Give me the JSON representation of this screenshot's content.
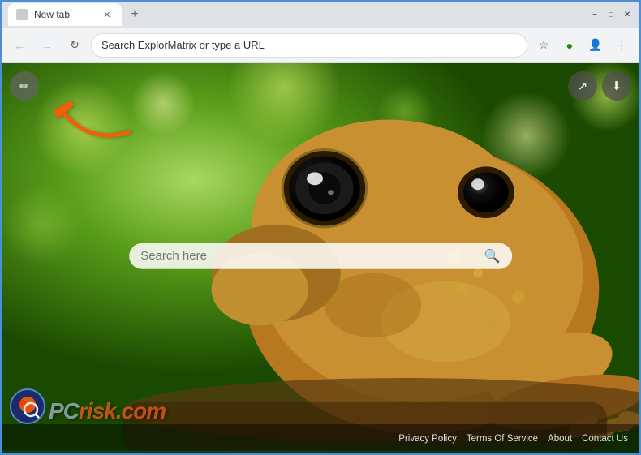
{
  "browser": {
    "tab_label": "New tab",
    "new_tab_btn": "+",
    "window_controls": {
      "minimize": "−",
      "maximize": "□",
      "close": "✕"
    }
  },
  "address_bar": {
    "back_btn": "←",
    "forward_btn": "→",
    "refresh_btn": "↻",
    "url_placeholder": "Search ExplorMatrix or type a URL",
    "url_value": "Search ExplorMatrix or type a URL",
    "bookmark_icon": "☆",
    "extension_icon": "●",
    "profile_icon": "👤",
    "menu_icon": "⋮"
  },
  "page": {
    "customize_btn_icon": "✏",
    "search_placeholder": "Search here",
    "search_icon": "🔍",
    "share_btn_icon": "↗",
    "save_btn_icon": "⬇"
  },
  "footer": {
    "privacy_policy": "Privacy Policy",
    "terms_of_service": "Terms Of Service",
    "about": "About",
    "contact_us": "Contact Us"
  },
  "colors": {
    "accent_blue": "#4a90d9",
    "tab_bg": "#ffffff",
    "address_bar_bg": "#f1f3f4",
    "footer_bg": "rgba(0,0,0,0.45)"
  }
}
